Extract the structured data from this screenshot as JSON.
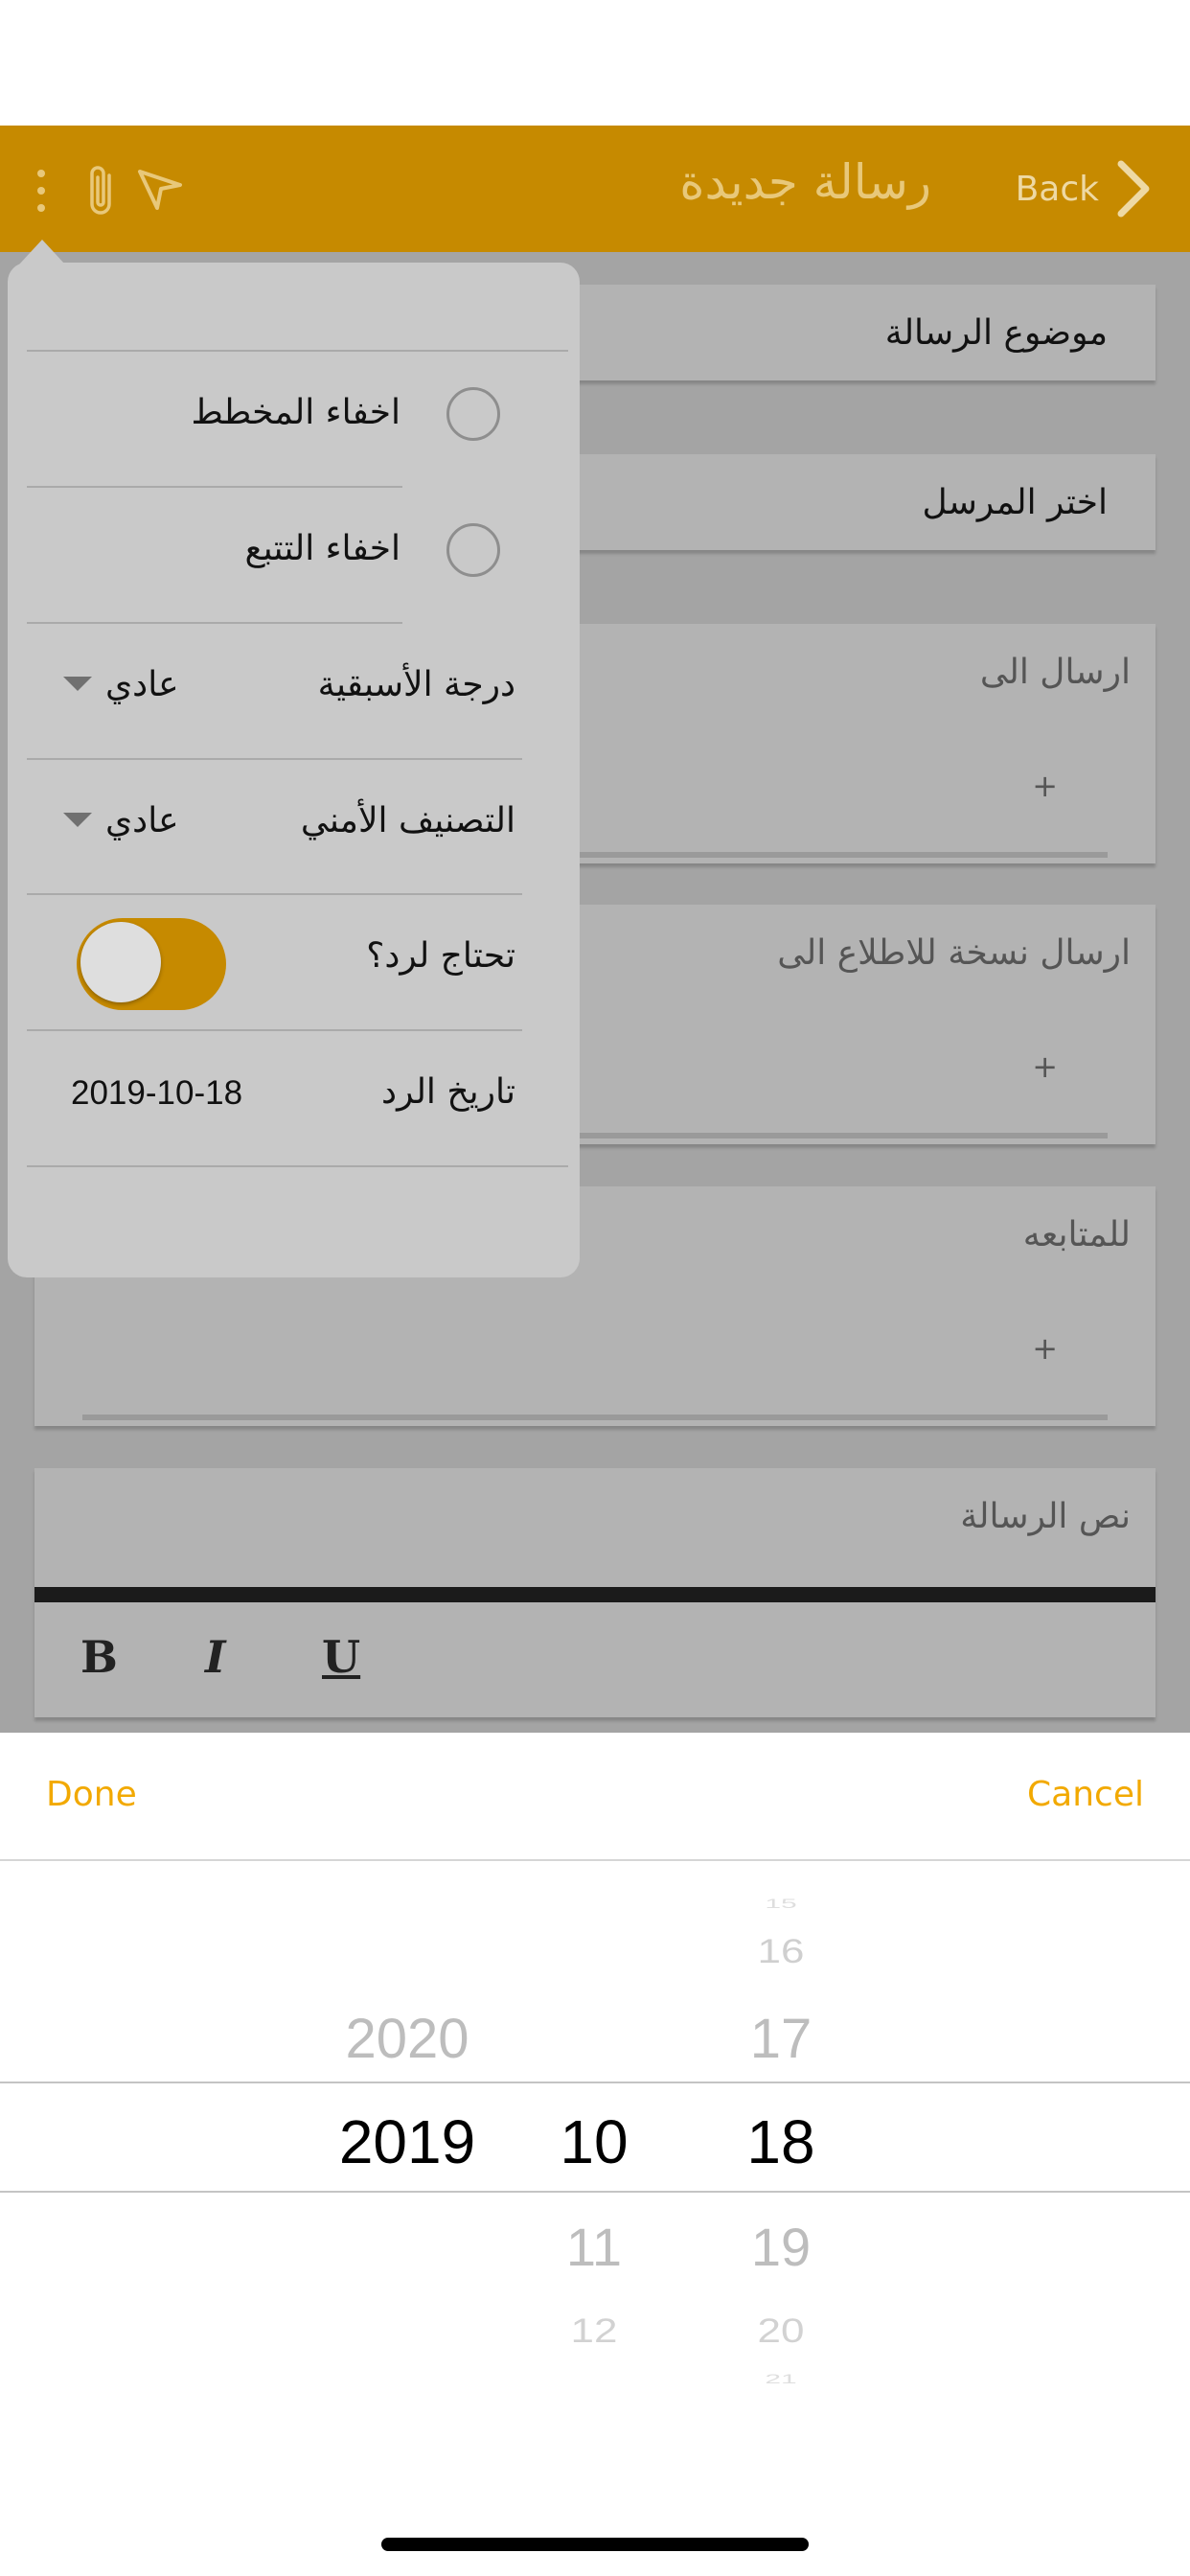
{
  "header": {
    "title": "رسالة جديدة",
    "back_label": "Back"
  },
  "form": {
    "subject_placeholder": "موضوع الرسالة",
    "sender_placeholder": "اختر المرسل",
    "send_to_label": "ارسال الى",
    "cc_label": "ارسال نسخة للاطلاع الى",
    "follow_up_label": "للمتابعه",
    "body_label": "نص الرسالة",
    "add_symbol": "+",
    "format": {
      "bold": "B",
      "italic": "I",
      "underline": "U"
    }
  },
  "popup": {
    "hide_diagram": "اخفاء المخطط",
    "hide_tracking": "اخفاء التتبع",
    "priority_label": "درجة الأسبقية",
    "priority_value": "عادي",
    "security_label": "التصنيف الأمني",
    "security_value": "عادي",
    "needs_reply_label": "تحتاج لرد؟",
    "needs_reply_on": true,
    "reply_date_label": "تاريخ الرد",
    "reply_date_value": "2019-10-18"
  },
  "picker": {
    "done_label": "Done",
    "cancel_label": "Cancel",
    "years": {
      "above": "2020",
      "selected": "2019"
    },
    "months": {
      "selected": "10",
      "below1": "11",
      "below2": "12"
    },
    "days": {
      "above3": "15",
      "above2": "16",
      "above1": "17",
      "selected": "18",
      "below1": "19",
      "below2": "20",
      "below3": "21"
    }
  },
  "colors": {
    "accent": "#c68a00",
    "picker_action": "#f2a900"
  }
}
